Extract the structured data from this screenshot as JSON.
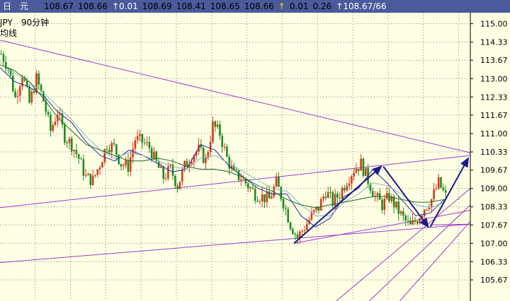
{
  "header": {
    "symbol_fragment": "日　元",
    "fields": [
      {
        "text": "108.67",
        "color": "#000000"
      },
      {
        "text": "108.66",
        "color": "#000000"
      },
      {
        "text": "↑0.01",
        "color": "#ffffff"
      },
      {
        "text": "108.69",
        "color": "#000000"
      },
      {
        "text": "108.41",
        "color": "#000000"
      },
      {
        "text": "108.65",
        "color": "#000000"
      },
      {
        "text": "108.66",
        "color": "#000000"
      },
      {
        "text": "↑",
        "color": "#ffd000"
      },
      {
        "text": "0.01",
        "color": "#000000"
      },
      {
        "text": "0.26",
        "color": "#000000"
      },
      {
        "text": "↑108.67/66",
        "color": "#ffffff"
      }
    ]
  },
  "info": {
    "symbol_period": "JPY　90分钟",
    "indicator_fragment": "均线"
  },
  "colors": {
    "background": "#ffffe4",
    "header_bg": "#4a5a9a",
    "bull": "#d23c1e",
    "bear": "#1e8c1e",
    "trendline": "#9a3cd2",
    "arrow": "#1a1a8c",
    "ma_fast": "#2a2aa0",
    "ma_mid": "#7fb9cc",
    "ma_slow": "#1d6a1d",
    "grid": "#808080"
  },
  "chart_data": {
    "type": "candlestick",
    "title": "",
    "grid": true,
    "ylim": [
      104.9,
      115.4
    ],
    "y_ticks": [
      115.0,
      114.33,
      113.67,
      113.0,
      112.33,
      111.67,
      111.0,
      110.33,
      109.67,
      109.0,
      108.33,
      107.67,
      107.0,
      106.33,
      105.67
    ],
    "x_count": 200,
    "close_path": [
      [
        0,
        113.9
      ],
      [
        3,
        113.4
      ],
      [
        6,
        112.3
      ],
      [
        9,
        113.2
      ],
      [
        12,
        112.1
      ],
      [
        15,
        113.0
      ],
      [
        18,
        112.2
      ],
      [
        21,
        111.1
      ],
      [
        24,
        111.8
      ],
      [
        27,
        110.9
      ],
      [
        30,
        110.6
      ],
      [
        33,
        110.1
      ],
      [
        36,
        109.4
      ],
      [
        39,
        109.3
      ],
      [
        42,
        109.9
      ],
      [
        45,
        110.6
      ],
      [
        48,
        110.5
      ],
      [
        51,
        109.9
      ],
      [
        54,
        109.8
      ],
      [
        57,
        110.8
      ],
      [
        60,
        110.7
      ],
      [
        63,
        110.5
      ],
      [
        66,
        109.9
      ],
      [
        69,
        109.4
      ],
      [
        72,
        109.7
      ],
      [
        75,
        109.1
      ],
      [
        78,
        109.8
      ],
      [
        81,
        110.2
      ],
      [
        84,
        110.4
      ],
      [
        87,
        110.0
      ],
      [
        90,
        111.3
      ],
      [
        93,
        111.0
      ],
      [
        96,
        110.1
      ],
      [
        99,
        109.5
      ],
      [
        102,
        109.4
      ],
      [
        105,
        109.1
      ],
      [
        108,
        108.8
      ],
      [
        111,
        108.7
      ],
      [
        114,
        108.6
      ],
      [
        117,
        109.2
      ],
      [
        120,
        108.5
      ],
      [
        123,
        107.7
      ],
      [
        126,
        107.2
      ],
      [
        129,
        107.6
      ],
      [
        132,
        108.0
      ],
      [
        135,
        108.3
      ],
      [
        138,
        108.9
      ],
      [
        141,
        108.5
      ],
      [
        144,
        108.8
      ],
      [
        147,
        109.3
      ],
      [
        150,
        109.7
      ],
      [
        153,
        109.9
      ],
      [
        156,
        109.3
      ],
      [
        159,
        108.7
      ],
      [
        162,
        108.4
      ],
      [
        165,
        108.7
      ],
      [
        168,
        108.3
      ],
      [
        171,
        107.9
      ],
      [
        174,
        107.6
      ],
      [
        177,
        107.9
      ],
      [
        180,
        108.3
      ],
      [
        183,
        108.6
      ],
      [
        186,
        109.2
      ],
      [
        189,
        108.7
      ]
    ],
    "candle_spread": 0.5,
    "series": [
      {
        "role": "ma_fast",
        "values": [
          113.4,
          112.9,
          112.7,
          112.4,
          111.8,
          111.4,
          110.7,
          110.2,
          110.0,
          110.4,
          110.2,
          109.9,
          109.6,
          109.7,
          110.6,
          110.4,
          109.8,
          109.4,
          109.0,
          108.8,
          108.8,
          108.0,
          107.6,
          107.9,
          108.7,
          109.0,
          109.7,
          109.2,
          108.6,
          108.0,
          108.1,
          108.6
        ]
      },
      {
        "role": "ma_mid",
        "values": [
          113.6,
          113.2,
          112.9,
          112.5,
          112.0,
          111.5,
          110.9,
          110.4,
          110.1,
          110.3,
          110.2,
          110.0,
          109.8,
          109.7,
          110.1,
          110.2,
          109.9,
          109.6,
          109.3,
          109.0,
          108.9,
          108.4,
          108.0,
          108.0,
          108.5,
          108.8,
          109.2,
          109.1,
          108.8,
          108.4,
          108.3,
          108.5
        ]
      },
      {
        "role": "ma_slow",
        "values": [
          113.5,
          113.3,
          112.9,
          112.3,
          111.6,
          111.1,
          110.6,
          110.4,
          110.2,
          110.0,
          110.0,
          110.1,
          110.0,
          109.8,
          109.7,
          109.7,
          109.6,
          109.4,
          109.1,
          108.9,
          108.6,
          108.4,
          108.3,
          108.4,
          108.5,
          108.6,
          108.7,
          108.7,
          108.6,
          108.5,
          108.5,
          108.6
        ]
      }
    ],
    "trendlines": [
      {
        "from": [
          0,
          114.4
        ],
        "to": [
          200,
          110.3
        ]
      },
      {
        "from": [
          0,
          108.3
        ],
        "to": [
          200,
          110.2
        ]
      },
      {
        "from": [
          0,
          106.3
        ],
        "to": [
          200,
          107.7
        ]
      },
      {
        "from": [
          125,
          107.0
        ],
        "to": [
          200,
          108.2
        ]
      },
      {
        "from": [
          143,
          104.9
        ],
        "to": [
          200,
          109.0
        ]
      },
      {
        "from": [
          157,
          104.9
        ],
        "to": [
          200,
          108.4
        ]
      },
      {
        "from": [
          170,
          104.9
        ],
        "to": [
          200,
          107.8
        ]
      },
      {
        "from": [
          183,
          107.67
        ],
        "to": [
          200,
          107.7
        ]
      }
    ],
    "arrows": [
      {
        "from": [
          125,
          107.0
        ],
        "to": [
          163,
          109.8
        ]
      },
      {
        "from": [
          163,
          109.8
        ],
        "to": [
          183,
          107.6
        ]
      },
      {
        "from": [
          183,
          107.6
        ],
        "to": [
          200,
          110.1
        ]
      }
    ]
  }
}
